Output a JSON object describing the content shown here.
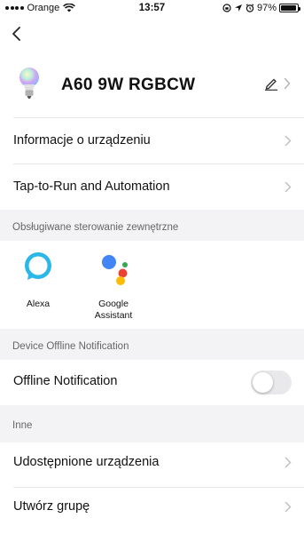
{
  "status_bar": {
    "carrier": "Orange",
    "time": "13:57",
    "battery": "97%",
    "battery_level": 0.97
  },
  "header": {
    "device_name": "A60  9W RGBCW"
  },
  "rows": {
    "device_info": "Informacje o urządzeniu",
    "tap_to_run": "Tap-to-Run and Automation"
  },
  "voice_section": {
    "title": "Obsługiwane sterowanie zewnętrzne",
    "items": [
      {
        "label": "Alexa",
        "icon": "alexa-icon"
      },
      {
        "label": "Google Assistant",
        "icon": "google-assistant-icon"
      }
    ]
  },
  "offline_section": {
    "title": "Device Offline Notification",
    "label": "Offline Notification",
    "enabled": false
  },
  "other_section": {
    "title": "Inne",
    "shared_devices": "Udostępnione urządzenia",
    "create_group": "Utwórz grupę"
  },
  "colors": {
    "alexa": "#2bb7e8",
    "toggle_off": "#e9e9eb",
    "section_bg": "#f3f3f5"
  }
}
